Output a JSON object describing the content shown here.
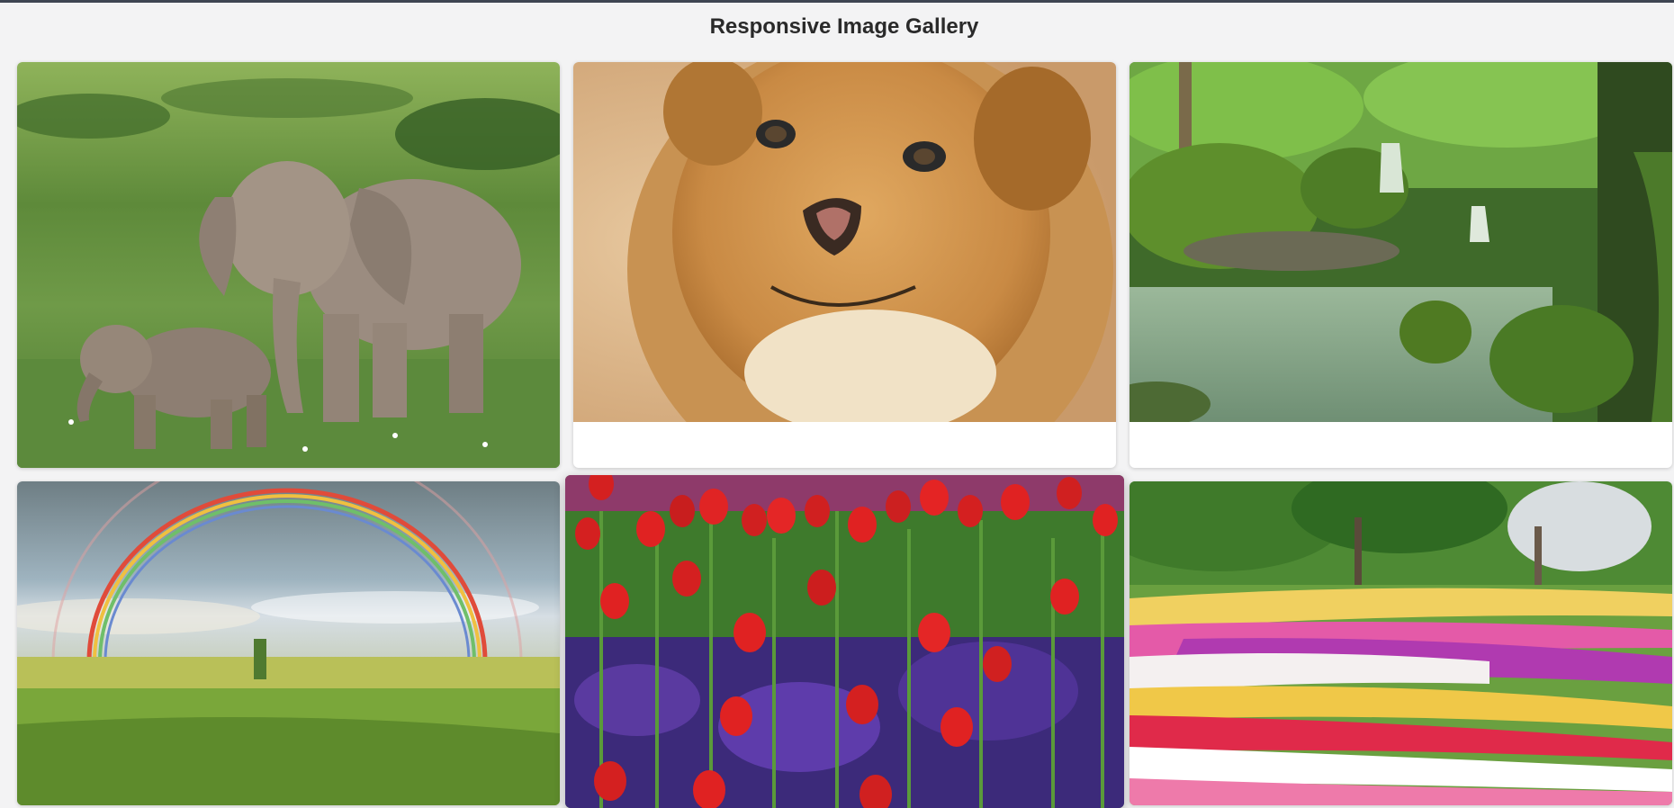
{
  "page": {
    "title": "Responsive Image Gallery"
  },
  "gallery": {
    "items": [
      {
        "icon": "elephant-photo"
      },
      {
        "icon": "lion-photo"
      },
      {
        "icon": "waterfall-photo"
      },
      {
        "icon": "rainbow-photo"
      },
      {
        "icon": "red-tulips-photo"
      },
      {
        "icon": "tulip-garden-photo"
      }
    ]
  },
  "colors": {
    "background": "#f3f3f4",
    "card": "#ffffff",
    "topbar": "#3e4552",
    "title": "#2a2a2a"
  }
}
